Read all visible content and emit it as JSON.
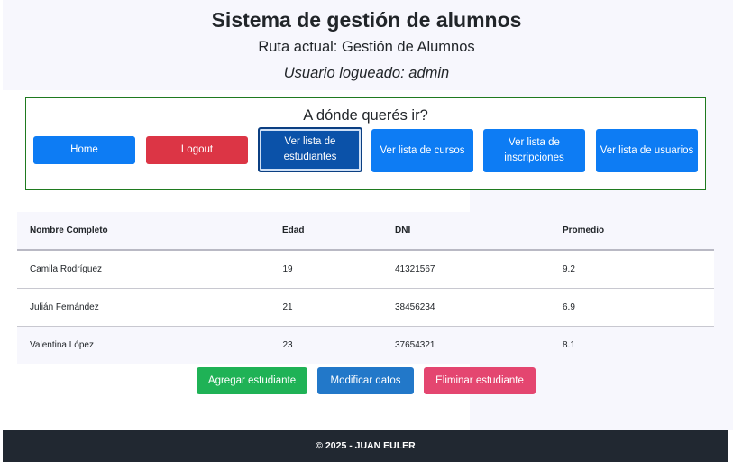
{
  "header": {
    "title": "Sistema de gestión de alumnos",
    "route": "Ruta actual: Gestión de Alumnos",
    "user": "Usuario logueado: admin"
  },
  "nav": {
    "title": "A dónde querés ir?",
    "buttons": [
      {
        "label": "Home"
      },
      {
        "label": "Logout"
      },
      {
        "label": "Ver lista de estudiantes"
      },
      {
        "label": "Ver lista de cursos"
      },
      {
        "label": "Ver lista de inscripciones"
      },
      {
        "label": "Ver lista de usuarios"
      }
    ]
  },
  "table": {
    "headers": [
      "Nombre Completo",
      "Edad",
      "DNI",
      "Promedio"
    ],
    "rows": [
      [
        "Camila Rodríguez",
        "19",
        "41321567",
        "9.2"
      ],
      [
        "Julián Fernández",
        "21",
        "38456234",
        "6.9"
      ],
      [
        "Valentina López",
        "23",
        "37654321",
        "8.1"
      ]
    ]
  },
  "actions": {
    "add": "Agregar estudiante",
    "modify": "Modificar datos",
    "delete": "Eliminar estudiante"
  },
  "footer": {
    "text": "© 2025 - JUAN EULER"
  },
  "colors": {
    "primary": "#0d7cf4",
    "danger": "#dc3545",
    "active": "#0b52a9",
    "success": "#1fb256",
    "footer": "#212831"
  }
}
